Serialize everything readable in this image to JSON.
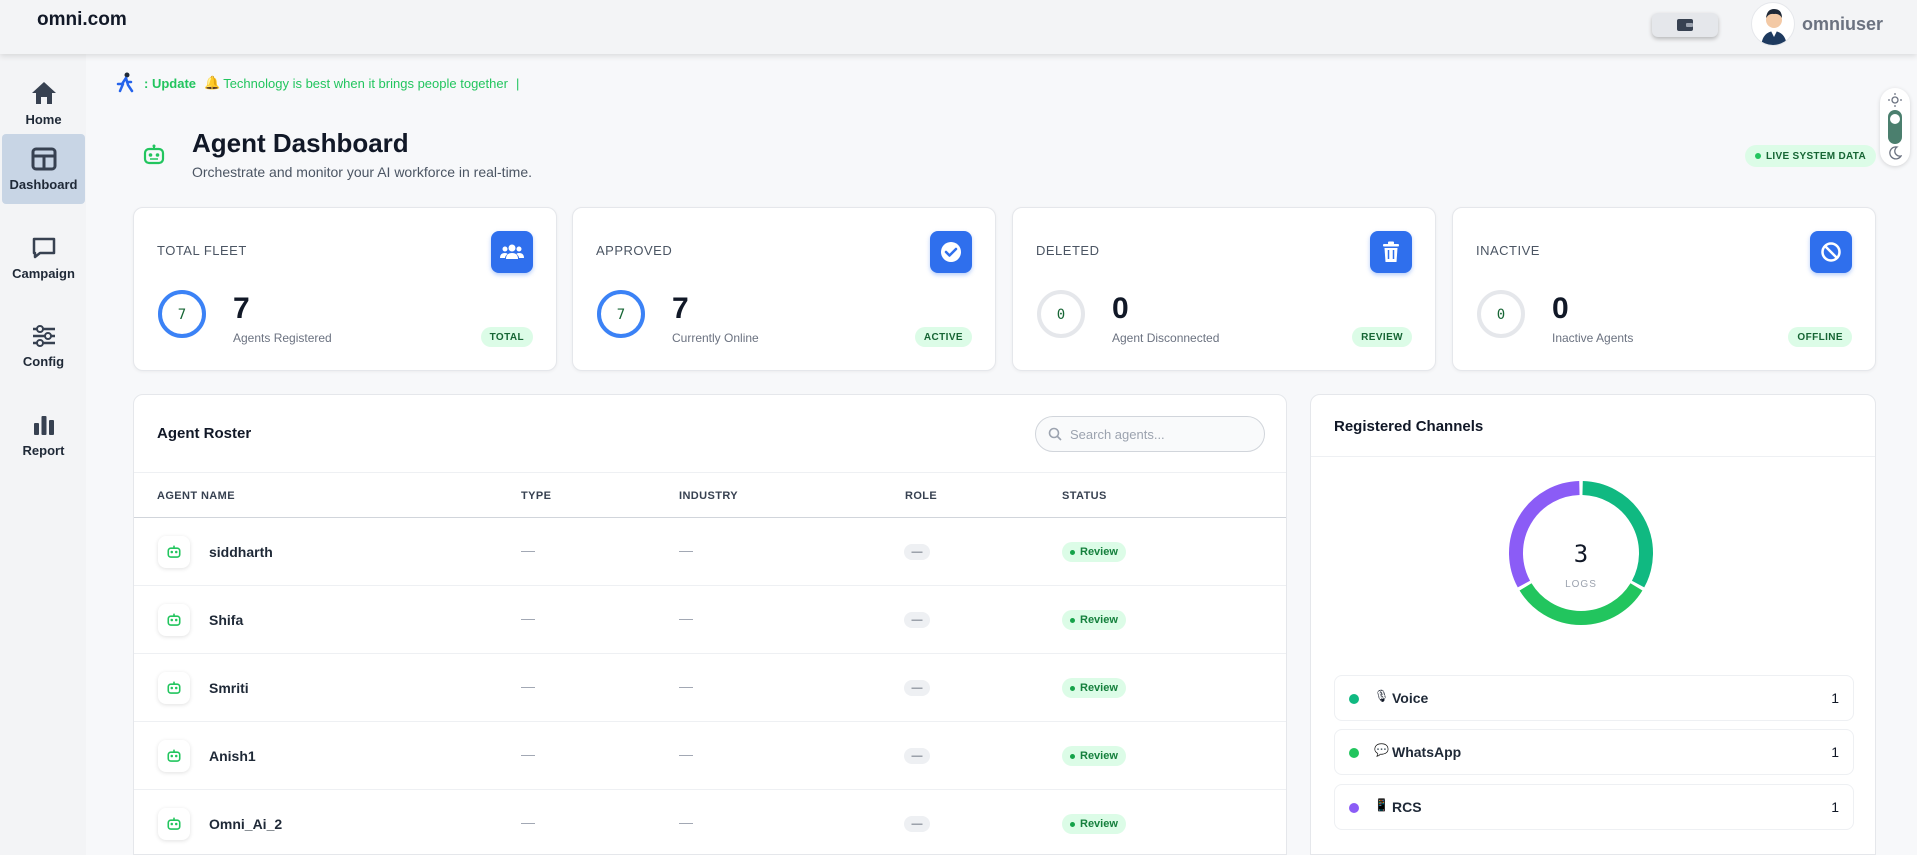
{
  "brand": "omni.com",
  "user": {
    "name": "omniuser"
  },
  "sidebar": {
    "items": [
      {
        "label": "Home",
        "icon": "home-icon"
      },
      {
        "label": "Dashboard",
        "icon": "dashboard-icon",
        "active": true
      },
      {
        "label": "Campaign",
        "icon": "chat-icon"
      },
      {
        "label": "Config",
        "icon": "sliders-icon"
      },
      {
        "label": "Report",
        "icon": "bar-chart-icon"
      }
    ]
  },
  "ticker": {
    "prefix": ": Update",
    "message": "Technology is best when it brings people together",
    "cursor": "|"
  },
  "header": {
    "title": "Agent Dashboard",
    "subtitle": "Orchestrate and monitor your AI workforce in real-time.",
    "live_badge": "LIVE SYSTEM DATA"
  },
  "stats": [
    {
      "label": "TOTAL FLEET",
      "value": "7",
      "ring": "7",
      "ring_fill": 1.0,
      "desc": "Agents Registered",
      "tag": "TOTAL",
      "icon": "users-icon"
    },
    {
      "label": "APPROVED",
      "value": "7",
      "ring": "7",
      "ring_fill": 1.0,
      "desc": "Currently Online",
      "tag": "ACTIVE",
      "icon": "check-circle-icon"
    },
    {
      "label": "DELETED",
      "value": "0",
      "ring": "0",
      "ring_fill": 0.0,
      "desc": "Agent Disconnected",
      "tag": "REVIEW",
      "icon": "trash-icon"
    },
    {
      "label": "INACTIVE",
      "value": "0",
      "ring": "0",
      "ring_fill": 0.0,
      "desc": "Inactive Agents",
      "tag": "OFFLINE",
      "icon": "ban-icon"
    }
  ],
  "roster": {
    "title": "Agent Roster",
    "search_placeholder": "Search agents...",
    "columns": [
      "AGENT NAME",
      "TYPE",
      "INDUSTRY",
      "ROLE",
      "STATUS"
    ],
    "rows": [
      {
        "name": "siddharth",
        "type": "—",
        "industry": "—",
        "role": "—",
        "status": "Review"
      },
      {
        "name": "Shifa",
        "type": "—",
        "industry": "—",
        "role": "—",
        "status": "Review"
      },
      {
        "name": "Smriti",
        "type": "—",
        "industry": "—",
        "role": "—",
        "status": "Review"
      },
      {
        "name": "Anish1",
        "type": "—",
        "industry": "—",
        "role": "—",
        "status": "Review"
      },
      {
        "name": "Omni_Ai_2",
        "type": "—",
        "industry": "—",
        "role": "—",
        "status": "Review"
      }
    ]
  },
  "channels": {
    "title": "Registered Channels",
    "total": "3",
    "total_label": "LOGS",
    "items": [
      {
        "name": "Voice",
        "emoji": "🎙",
        "count": "1",
        "color": "#10b981"
      },
      {
        "name": "WhatsApp",
        "emoji": "💬",
        "count": "1",
        "color": "#22c55e"
      },
      {
        "name": "RCS",
        "emoji": "📱",
        "count": "1",
        "color": "#8b5cf6"
      }
    ]
  },
  "colors": {
    "accent": "#2f6fed",
    "success": "#22c55e",
    "badge_bg": "#dcfce7",
    "active_nav": "#c8d5e5"
  }
}
